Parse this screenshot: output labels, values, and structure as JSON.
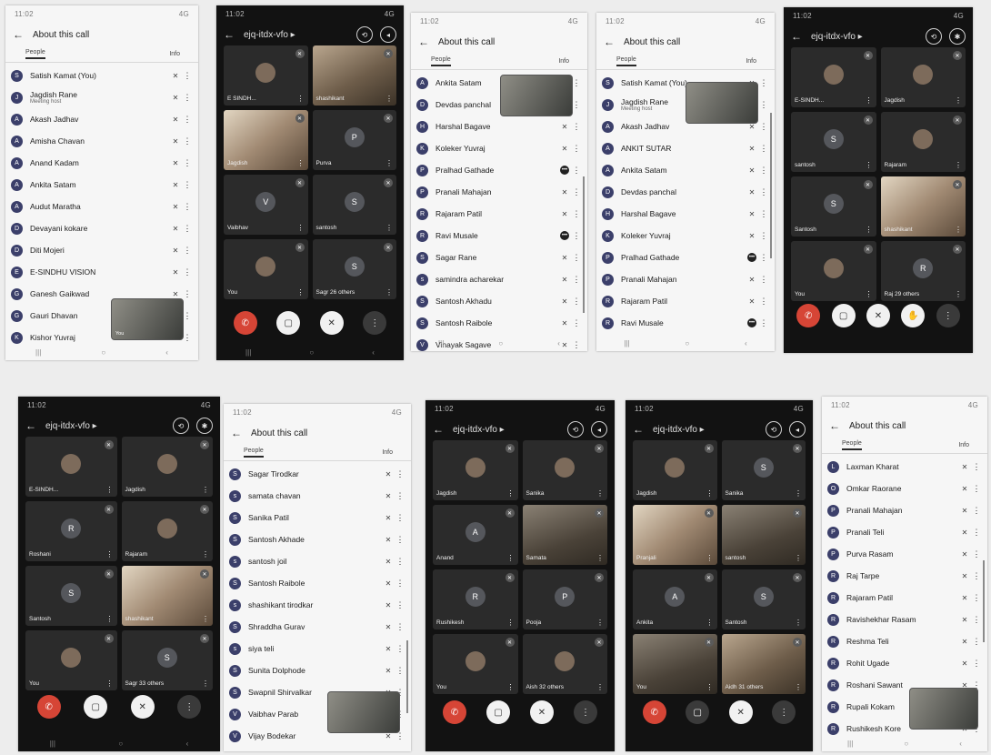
{
  "common": {
    "status_left": "11:02",
    "status_right": "4G",
    "about_title": "About this call",
    "tab_people": "People",
    "tab_info": "Info",
    "meeting_code": "ejq-itdx-vfo ▸",
    "you": "You",
    "more_icon": "⋮",
    "mic_off_icon": "mic-off",
    "nav_back": "‹",
    "nav_home": "○",
    "nav_recent": "|||"
  },
  "s1": {
    "rows": [
      {
        "name": "Satish Kamat (You)",
        "mic": false
      },
      {
        "name": "Jagdish Rane",
        "sub": "Meeting host",
        "mic": true
      },
      {
        "name": "Akash Jadhav",
        "mic": true
      },
      {
        "name": "Amisha Chavan",
        "mic": true
      },
      {
        "name": "Anand Kadam",
        "mic": true
      },
      {
        "name": "Ankita Satam",
        "mic": true
      },
      {
        "name": "Audut Maratha",
        "mic": true
      },
      {
        "name": "Devayani kokare",
        "mic": true
      },
      {
        "name": "Diti Mojeri",
        "mic": true
      },
      {
        "name": "E-SINDHU VISION",
        "mic": false
      },
      {
        "name": "Ganesh Gaikwad",
        "mic": false
      },
      {
        "name": "Gauri Dhavan",
        "mic": false
      },
      {
        "name": "Kishor Yuvraj",
        "mic": true
      }
    ],
    "pip_label": "You"
  },
  "s2": {
    "tiles": [
      {
        "name": "E SINDH...",
        "letter": "",
        "photo": true
      },
      {
        "name": "shashikant",
        "letter": "",
        "video": true
      },
      {
        "name": "Jagdish",
        "letter": "",
        "video": true
      },
      {
        "name": "Purva",
        "letter": "P"
      },
      {
        "name": "Vaibhav",
        "letter": "V"
      },
      {
        "name": "santosh",
        "letter": "S"
      },
      {
        "name": "You",
        "letter": "",
        "photo": true
      },
      {
        "name": "Sagr 26 others",
        "letter": "S"
      }
    ]
  },
  "s3": {
    "rows": [
      {
        "name": "Ankita Satam"
      },
      {
        "name": "Devdas panchal"
      },
      {
        "name": "Harshal Bagave"
      },
      {
        "name": "Koleker Yuvraj"
      },
      {
        "name": "Pralhad Gathade",
        "active": true
      },
      {
        "name": "Pranali Mahajan"
      },
      {
        "name": "Rajaram Patil"
      },
      {
        "name": "Ravi Musale",
        "active": true
      },
      {
        "name": "Sagar Rane"
      },
      {
        "name": "samindra acharekar"
      },
      {
        "name": "Santosh Akhadu"
      },
      {
        "name": "Santosh Raibole"
      },
      {
        "name": "Vinayak Sagave"
      }
    ]
  },
  "s4": {
    "rows": [
      {
        "name": "Satish Kamat (You)"
      },
      {
        "name": "Jagdish Rane",
        "sub": "Meeting host"
      },
      {
        "name": "Akash Jadhav"
      },
      {
        "name": "ANKIT SUTAR"
      },
      {
        "name": "Ankita Satam"
      },
      {
        "name": "Devdas panchal"
      },
      {
        "name": "Harshal Bagave"
      },
      {
        "name": "Koleker Yuvraj"
      },
      {
        "name": "Pralhad Gathade",
        "active": true
      },
      {
        "name": "Pranali Mahajan"
      },
      {
        "name": "Rajaram Patil"
      },
      {
        "name": "Ravi Musale",
        "active": true
      }
    ]
  },
  "s5": {
    "tiles": [
      {
        "name": "E-SINDH...",
        "letter": "",
        "photo": true
      },
      {
        "name": "Jagdish",
        "letter": "",
        "photo": true
      },
      {
        "name": "santosh",
        "letter": "S"
      },
      {
        "name": "Rajaram",
        "letter": "",
        "photo": true
      },
      {
        "name": "Santosh",
        "letter": "S"
      },
      {
        "name": "shashikant",
        "letter": "",
        "video": true
      },
      {
        "name": "You",
        "letter": "",
        "photo": true
      },
      {
        "name": "Raj 29 others",
        "letter": "R"
      }
    ]
  },
  "s6": {
    "tiles": [
      {
        "name": "E-SINDH...",
        "letter": "",
        "photo": true
      },
      {
        "name": "Jagdish",
        "letter": "",
        "photo": true
      },
      {
        "name": "Roshani",
        "letter": "R"
      },
      {
        "name": "Rajaram",
        "letter": "",
        "photo": true
      },
      {
        "name": "Santosh",
        "letter": "S"
      },
      {
        "name": "shashikant",
        "letter": "",
        "video": true
      },
      {
        "name": "You",
        "letter": "",
        "photo": true
      },
      {
        "name": "Sagr 33 others",
        "letter": "S"
      }
    ]
  },
  "s7": {
    "rows": [
      {
        "name": "Sagar Tirodkar"
      },
      {
        "name": "samata chavan"
      },
      {
        "name": "Sanika Patil"
      },
      {
        "name": "Santosh Akhade"
      },
      {
        "name": "santosh joil"
      },
      {
        "name": "Santosh Raibole"
      },
      {
        "name": "shashikant tirodkar"
      },
      {
        "name": "Shraddha Gurav"
      },
      {
        "name": "siya teli"
      },
      {
        "name": "Sunita Dolphode"
      },
      {
        "name": "Swapnil Shirvalkar"
      },
      {
        "name": "Vaibhav Parab"
      },
      {
        "name": "Vijay Bodekar"
      }
    ]
  },
  "s8": {
    "tiles": [
      {
        "name": "Jagdish",
        "letter": "",
        "photo": true
      },
      {
        "name": "Sanika",
        "letter": "",
        "photo": true
      },
      {
        "name": "Anand",
        "letter": "A"
      },
      {
        "name": "Samata",
        "letter": "",
        "video": true
      },
      {
        "name": "Rushikesh",
        "letter": "R"
      },
      {
        "name": "Pooja",
        "letter": "P"
      },
      {
        "name": "You",
        "letter": "",
        "photo": true
      },
      {
        "name": "Aish 32 others",
        "letter": "",
        "photo": true
      }
    ]
  },
  "s9": {
    "tiles": [
      {
        "name": "Jagdish",
        "letter": "",
        "photo": true
      },
      {
        "name": "Sanika",
        "letter": "S"
      },
      {
        "name": "Pranjali",
        "letter": "",
        "video": true
      },
      {
        "name": "santosh",
        "letter": "",
        "video": true
      },
      {
        "name": "Ankita",
        "letter": "A"
      },
      {
        "name": "Santosh",
        "letter": "S"
      },
      {
        "name": "You",
        "letter": "",
        "video": true
      },
      {
        "name": "Aidh 31 others",
        "letter": "",
        "video": true
      }
    ]
  },
  "s10": {
    "rows": [
      {
        "name": "Laxman Kharat"
      },
      {
        "name": "Omkar Raorane"
      },
      {
        "name": "Pranali Mahajan"
      },
      {
        "name": "Pranali Teli"
      },
      {
        "name": "Purva Rasam"
      },
      {
        "name": "Raj Tarpe"
      },
      {
        "name": "Rajaram Patil"
      },
      {
        "name": "Ravishekhar Rasam"
      },
      {
        "name": "Reshma Teli"
      },
      {
        "name": "Rohit Ugade"
      },
      {
        "name": "Roshani Sawant"
      },
      {
        "name": "Rupali Kokam"
      },
      {
        "name": "Rushikesh Kore"
      }
    ]
  }
}
